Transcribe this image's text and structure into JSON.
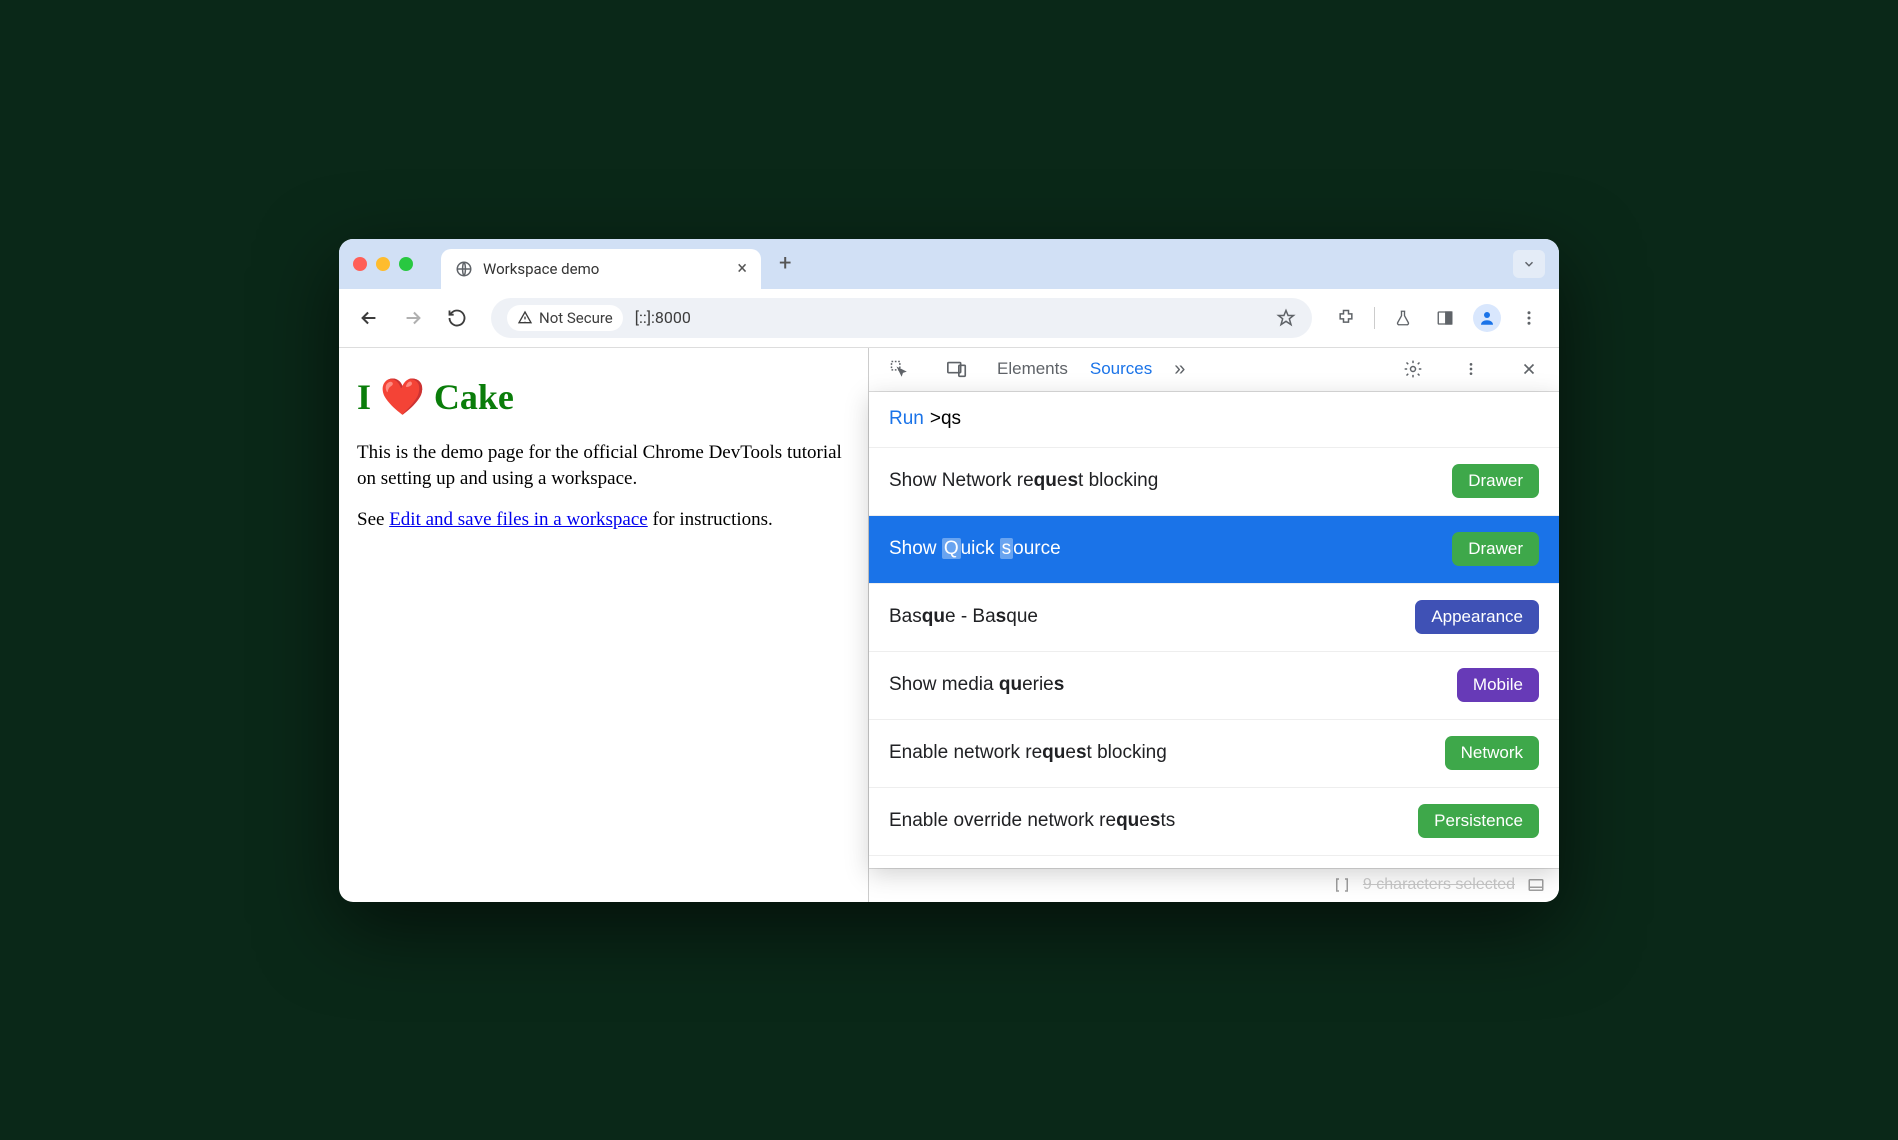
{
  "tab": {
    "title": "Workspace demo"
  },
  "address": {
    "secure_label": "Not Secure",
    "url": "[::]:8000"
  },
  "page": {
    "heading": "I ❤️ Cake",
    "p1": "This is the demo page for the official Chrome DevTools tutorial on setting up and using a workspace.",
    "p2_prefix": "See ",
    "p2_link": "Edit and save files in a workspace",
    "p2_suffix": " for instructions."
  },
  "devtools": {
    "tabs": {
      "elements": "Elements",
      "sources": "Sources"
    },
    "command": {
      "run_label": "Run",
      "query": ">qs"
    },
    "items": [
      {
        "pre": "Show Network re",
        "b1": "qu",
        "mid1": "e",
        "b2": "s",
        "mid2": "t blocking",
        "badge": "Drawer",
        "badgeClass": "green"
      },
      {
        "pre": "Show ",
        "hl1": "Q",
        "mid1": "uick ",
        "hl2": "s",
        "mid2": "ource",
        "badge": "Drawer",
        "badgeClass": "green",
        "selected": true
      },
      {
        "pre": "Bas",
        "b1": "qu",
        "mid1": "e - Ba",
        "b2": "s",
        "mid2": "que",
        "badge": "Appearance",
        "badgeClass": "indigo"
      },
      {
        "pre": "Show media ",
        "b1": "qu",
        "mid1": "erie",
        "b2": "s",
        "mid2": "",
        "badge": "Mobile",
        "badgeClass": "purple"
      },
      {
        "pre": "Enable network re",
        "b1": "qu",
        "mid1": "e",
        "b2": "s",
        "mid2": "t blocking",
        "badge": "Network",
        "badgeClass": "green"
      },
      {
        "pre": "Enable override network re",
        "b1": "qu",
        "mid1": "e",
        "b2": "s",
        "mid2": "ts",
        "badge": "Persistence",
        "badgeClass": "green"
      }
    ],
    "status": "9 characters selected"
  }
}
